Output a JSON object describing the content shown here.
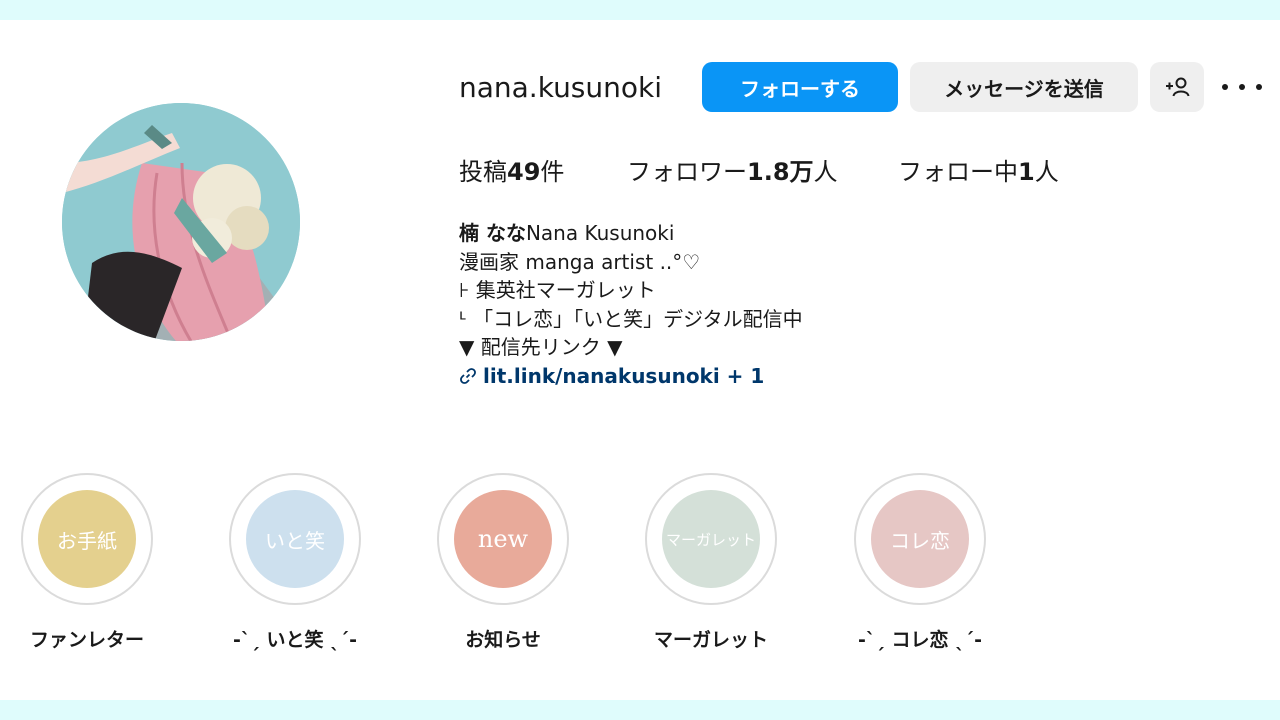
{
  "profile": {
    "username": "nana.kusunoki",
    "follow_button": "フォローする",
    "message_button": "メッセージを送信",
    "add_user_symbol": "+",
    "stats": {
      "posts_prefix": "投稿",
      "posts_count": "49",
      "posts_suffix": "件",
      "followers_prefix": "フォロワー",
      "followers_count": "1.8万",
      "followers_suffix": "人",
      "following_prefix": "フォロー中",
      "following_count": "1",
      "following_suffix": "人"
    },
    "bio": {
      "name": "楠 なな",
      "name_en": "Nana Kusunoki",
      "line1": "漫画家 manga artist ..°♡",
      "line2": "⊦ 集英社マーガレット",
      "line3": "ᒻ 「コレ恋」「いと笑」デジタル配信中",
      "line4": "▼ 配信先リンク ▼",
      "link": "lit.link/nanakusunoki + 1"
    }
  },
  "highlights": [
    {
      "cover_text": "お手紙",
      "label": "ファンレター",
      "color": "#e4d08e"
    },
    {
      "cover_text": "いと笑",
      "label": "-ˋˏ いと笑 ˎˊ-",
      "color": "#cde0ee"
    },
    {
      "cover_text": "new",
      "label": "お知らせ",
      "color": "#e8aa9a"
    },
    {
      "cover_text": "マーガレット",
      "label": "マーガレット",
      "color": "#d4e0d8"
    },
    {
      "cover_text": "コレ恋",
      "label": "-ˋˏ コレ恋 ˎˊ-",
      "color": "#e6c7c5"
    }
  ],
  "colors": {
    "accent": "#0a95f6",
    "link": "#00376b",
    "background": "#dffcfc"
  },
  "icons": [
    "add-user-icon",
    "more-icon",
    "link-icon"
  ]
}
